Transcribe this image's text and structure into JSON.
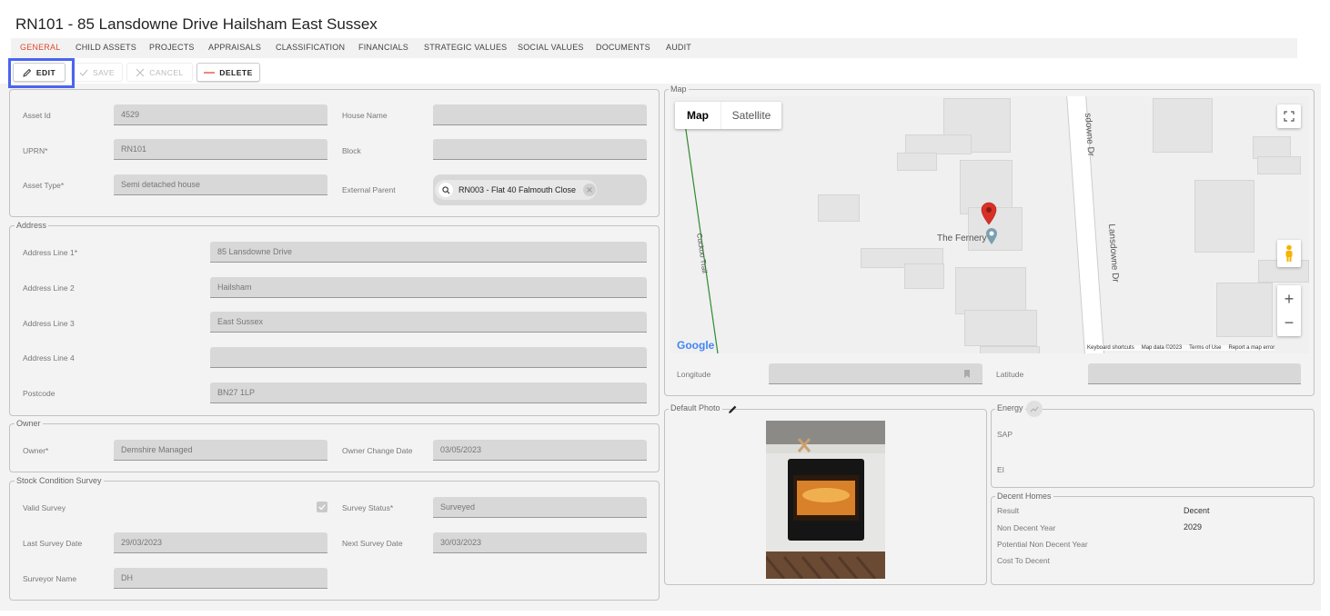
{
  "header": {
    "title": "RN101 - 85 Lansdowne Drive Hailsham East Sussex"
  },
  "tabs": [
    {
      "label": "GENERAL",
      "active": true
    },
    {
      "label": "CHILD ASSETS"
    },
    {
      "label": "PROJECTS"
    },
    {
      "label": "APPRAISALS"
    },
    {
      "label": "CLASSIFICATION"
    },
    {
      "label": "FINANCIALS"
    },
    {
      "label": "STRATEGIC VALUES"
    },
    {
      "label": "SOCIAL VALUES"
    },
    {
      "label": "DOCUMENTS"
    },
    {
      "label": "AUDIT"
    }
  ],
  "toolbar": {
    "edit": "EDIT",
    "save": "SAVE",
    "cancel": "CANCEL",
    "delete": "DELETE"
  },
  "asset_details": {
    "asset_id_label": "Asset Id",
    "asset_id": "4529",
    "house_name_label": "House Name",
    "house_name": "",
    "uprn_label": "UPRN*",
    "uprn": "RN101",
    "block_label": "Block",
    "block": "",
    "asset_type_label": "Asset Type*",
    "asset_type": "Semi detached house",
    "external_parent_label": "External Parent",
    "external_parent": "RN003 - Flat 40 Falmouth Close"
  },
  "address": {
    "legend": "Address",
    "line1_label": "Address Line 1*",
    "line1": "85 Lansdowne Drive",
    "line2_label": "Address Line 2",
    "line2": "Hailsham",
    "line3_label": "Address Line 3",
    "line3": "East Sussex",
    "line4_label": "Address Line 4",
    "line4": "",
    "postcode_label": "Postcode",
    "postcode": "BN27 1LP"
  },
  "owner": {
    "legend": "Owner",
    "owner_label": "Owner*",
    "owner": "Demshire Managed",
    "change_date_label": "Owner Change Date",
    "change_date": "03/05/2023"
  },
  "survey": {
    "legend": "Stock Condition Survey",
    "valid_label": "Valid Survey",
    "valid": true,
    "status_label": "Survey Status*",
    "status": "Surveyed",
    "last_date_label": "Last Survey Date",
    "last_date": "29/03/2023",
    "next_date_label": "Next Survey Date",
    "next_date": "30/03/2023",
    "surveyor_label": "Surveyor Name",
    "surveyor": "DH"
  },
  "map": {
    "legend": "Map",
    "type_map": "Map",
    "type_satellite": "Satellite",
    "street_a": "Lansdowne Dr",
    "street_b": "sdowne Dr",
    "trail": "Cuckoo Trail",
    "place": "The Fernery",
    "logo": "Google",
    "shortcuts": "Keyboard shortcuts",
    "mapdata": "Map data ©2023",
    "terms": "Terms of Use",
    "report": "Report a map error",
    "longitude_label": "Longitude",
    "longitude": "",
    "latitude_label": "Latitude",
    "latitude": ""
  },
  "photo": {
    "legend": "Default Photo"
  },
  "energy": {
    "legend": "Energy",
    "sap_label": "SAP",
    "ei_label": "EI"
  },
  "decent_homes": {
    "legend": "Decent Homes",
    "result_label": "Result",
    "result": "Decent",
    "non_decent_year_label": "Non Decent Year",
    "non_decent_year": "2029",
    "potential_label": "Potential Non Decent Year",
    "potential": "",
    "cost_label": "Cost To Decent",
    "cost": ""
  },
  "colors": {
    "accent": "#e04a2f",
    "highlight": "#4b64f0",
    "pin": "#d93025"
  }
}
